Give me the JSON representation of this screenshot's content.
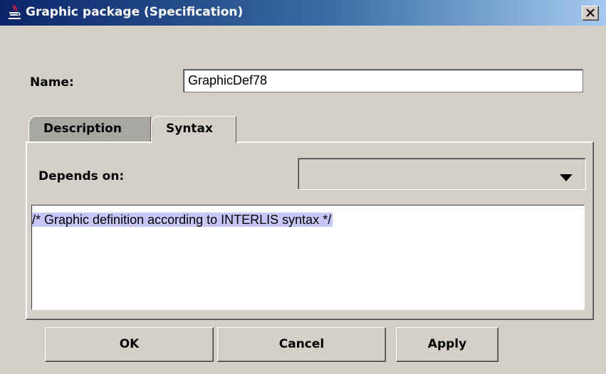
{
  "window": {
    "title": "Graphic package (Specification)",
    "icon": "java-cup-icon",
    "close_icon": "close-icon"
  },
  "form": {
    "name_label": "Name:",
    "name_value": "GraphicDef78"
  },
  "tabs": [
    {
      "label": "Description",
      "selected": false
    },
    {
      "label": "Syntax",
      "selected": true
    }
  ],
  "syntax_tab": {
    "depends_on_label": "Depends on:",
    "depends_on_value": "",
    "syntax_text": "/* Graphic definition according to INTERLIS syntax */"
  },
  "buttons": {
    "ok": "OK",
    "cancel": "Cancel",
    "apply": "Apply"
  },
  "colors": {
    "title_gradient_start": "#0a246a",
    "title_gradient_end": "#a6caf0",
    "window_bg": "#d4d0c8",
    "selection": "#c6c6f8"
  }
}
